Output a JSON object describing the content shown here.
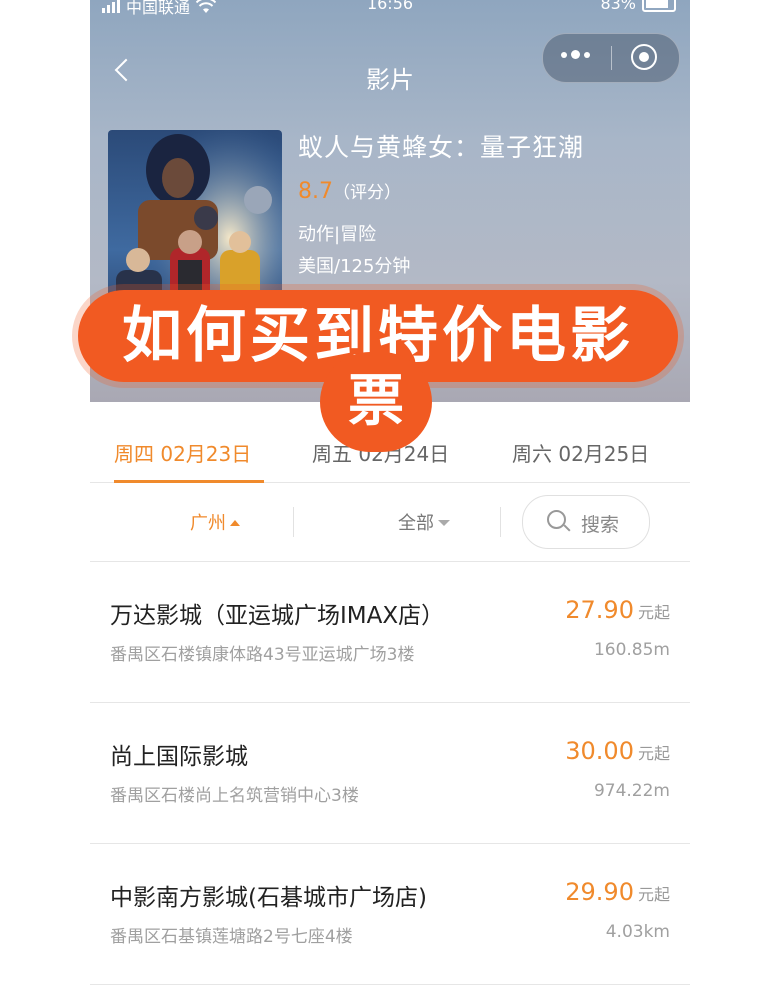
{
  "status_bar": {
    "carrier": "中国联通",
    "time": "16:56",
    "battery": "83%"
  },
  "nav": {
    "title": "影片"
  },
  "movie": {
    "title": "蚁人与黄蜂女：量子狂潮",
    "rating": "8.7",
    "rating_label": "（评分）",
    "genre": "动作|冒险",
    "country_duration": "美国/125分钟"
  },
  "overlay": {
    "line1": "如何买到特价电影",
    "line2": "票"
  },
  "tabs": [
    {
      "label": "周四 02月23日",
      "active": true
    },
    {
      "label": "周五 02月24日",
      "active": false
    },
    {
      "label": "周六 02月25日",
      "active": false
    }
  ],
  "filters": {
    "city": "广州",
    "category": "全部",
    "search_label": "搜索"
  },
  "cinemas": [
    {
      "name": "万达影城（亚运城广场IMAX店）",
      "address": "番禺区石楼镇康体路43号亚运城广场3楼",
      "price": "27.90",
      "price_unit": "元起",
      "distance": "160.85m"
    },
    {
      "name": "尚上国际影城",
      "address": "番禺区石楼尚上名筑营销中心3楼",
      "price": "30.00",
      "price_unit": "元起",
      "distance": "974.22m"
    },
    {
      "name": "中影南方影城(石碁城市广场店)",
      "address": "番禺区石基镇莲塘路2号七座4楼",
      "price": "29.90",
      "price_unit": "元起",
      "distance": "4.03km"
    }
  ],
  "colors": {
    "accent": "#f08a2c",
    "overlay_red": "#f15a22"
  },
  "icons": [
    "signal-icon",
    "wifi-icon",
    "battery-icon",
    "back-icon",
    "more-icon",
    "record-icon",
    "search-icon"
  ]
}
